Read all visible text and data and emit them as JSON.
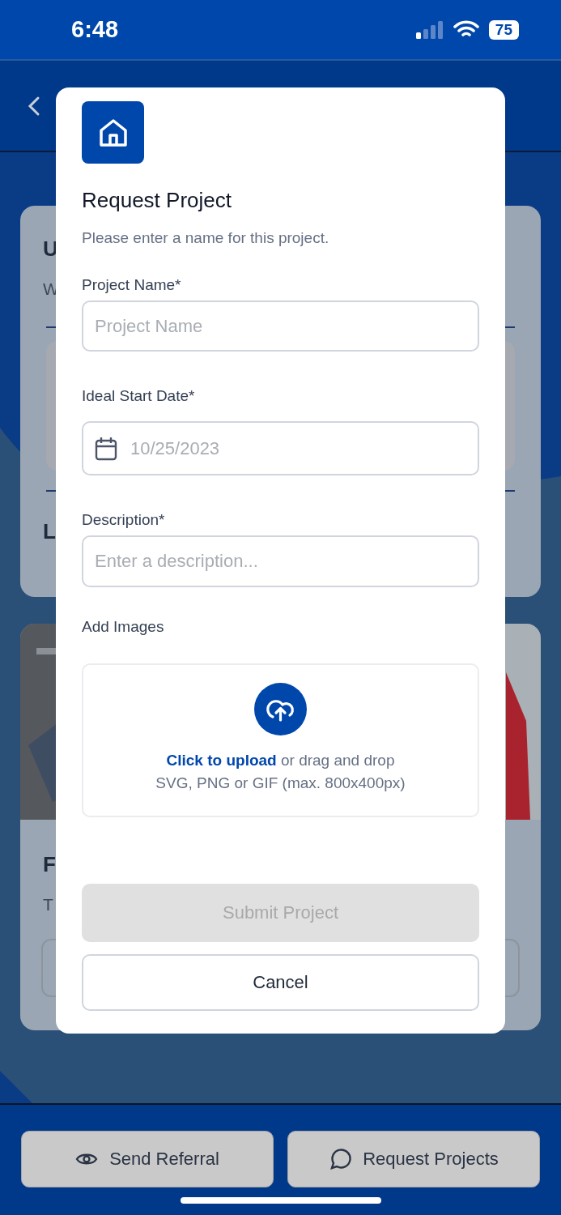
{
  "status_bar": {
    "time": "6:48",
    "battery": "75"
  },
  "background_cards": [
    {
      "kind": "info",
      "title": "U",
      "subtitle": "W",
      "footer": "L"
    },
    {
      "title": "F",
      "subtitle": "T"
    }
  ],
  "modal": {
    "title": "Request Project",
    "subtitle": "Please enter a name for this project.",
    "fields": [
      {
        "kind": "text",
        "label": "Project Name*",
        "placeholder": "Project Name"
      },
      {
        "kind": "date",
        "label": "Ideal Start Date*",
        "placeholder": "10/25/2023"
      },
      {
        "kind": "text",
        "label": "Description*",
        "placeholder": "Enter a description..."
      }
    ],
    "upload": {
      "label": "Add Images",
      "link": "Click to upload",
      "text": "or drag and drop",
      "hint": "SVG, PNG or GIF (max. 800x400px)"
    },
    "submit": {
      "label": "Submit Project",
      "disabled": true
    },
    "cancel": {
      "label": "Cancel"
    }
  },
  "bottom_bar": {
    "buttons": [
      {
        "label": "Send Referral"
      },
      {
        "label": "Request Projects"
      }
    ]
  }
}
